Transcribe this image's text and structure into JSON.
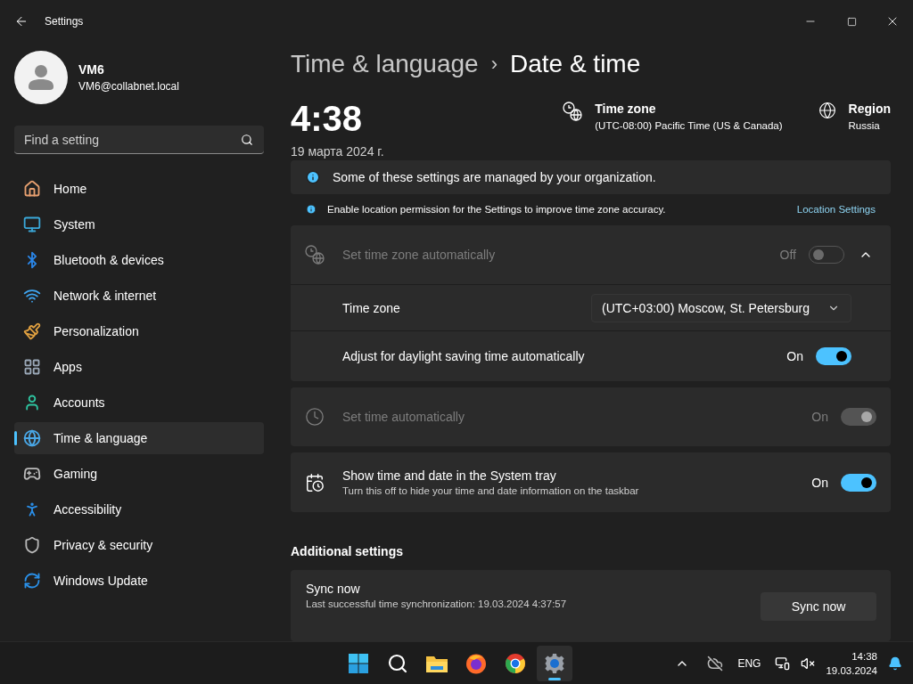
{
  "window": {
    "title": "Settings"
  },
  "user": {
    "name": "VM6",
    "email": "VM6@collabnet.local"
  },
  "search": {
    "placeholder": "Find a setting"
  },
  "nav": [
    {
      "label": "Home",
      "selected": false
    },
    {
      "label": "System",
      "selected": false
    },
    {
      "label": "Bluetooth & devices",
      "selected": false
    },
    {
      "label": "Network & internet",
      "selected": false
    },
    {
      "label": "Personalization",
      "selected": false
    },
    {
      "label": "Apps",
      "selected": false
    },
    {
      "label": "Accounts",
      "selected": false
    },
    {
      "label": "Time & language",
      "selected": true
    },
    {
      "label": "Gaming",
      "selected": false
    },
    {
      "label": "Accessibility",
      "selected": false
    },
    {
      "label": "Privacy & security",
      "selected": false
    },
    {
      "label": "Windows Update",
      "selected": false
    }
  ],
  "breadcrumb": {
    "parent": "Time & language",
    "separator": "›",
    "current": "Date & time"
  },
  "clock": {
    "time": "4:38",
    "date": "19 марта 2024 г."
  },
  "summary": [
    {
      "kind": "timezone",
      "label": "Time zone",
      "value": "(UTC-08:00) Pacific Time (US & Canada)"
    },
    {
      "kind": "region",
      "label": "Region",
      "value": "Russia"
    }
  ],
  "notice": {
    "text": "Some of these settings are managed by your organization."
  },
  "location_notice": {
    "text": "Enable location permission for the Settings to improve time zone accuracy.",
    "link": "Location Settings"
  },
  "cards": [
    {
      "kind": "timezone",
      "title": "Set time zone automatically",
      "state": "Off",
      "on": false,
      "disabled": true,
      "expanded": true,
      "children": [
        {
          "kind": "dropdown",
          "label": "Time zone",
          "value": "(UTC+03:00) Moscow, St. Petersburg"
        },
        {
          "kind": "toggle",
          "label": "Adjust for daylight saving time automatically",
          "state": "On",
          "on": true
        }
      ]
    },
    {
      "kind": "clock",
      "title": "Set time automatically",
      "state": "On",
      "on": true,
      "disabled": true
    },
    {
      "kind": "calendar",
      "title": "Show time and date in the System tray",
      "description": "Turn this off to hide your time and date information on the taskbar",
      "state": "On",
      "on": true,
      "disabled": false
    }
  ],
  "additional": {
    "heading": "Additional settings",
    "sync": {
      "title": "Sync now",
      "description": "Last successful time synchronization: 19.03.2024 4:37:57",
      "button": "Sync now"
    }
  },
  "taskbar": {
    "apps": [
      {
        "kind": "start",
        "selected": false
      },
      {
        "kind": "search",
        "selected": false
      },
      {
        "kind": "explorer",
        "selected": false
      },
      {
        "kind": "firefox",
        "selected": false
      },
      {
        "kind": "chrome",
        "selected": false
      },
      {
        "kind": "settings",
        "selected": true
      }
    ],
    "language": "ENG",
    "time": "14:38",
    "date": "19.03.2024"
  }
}
